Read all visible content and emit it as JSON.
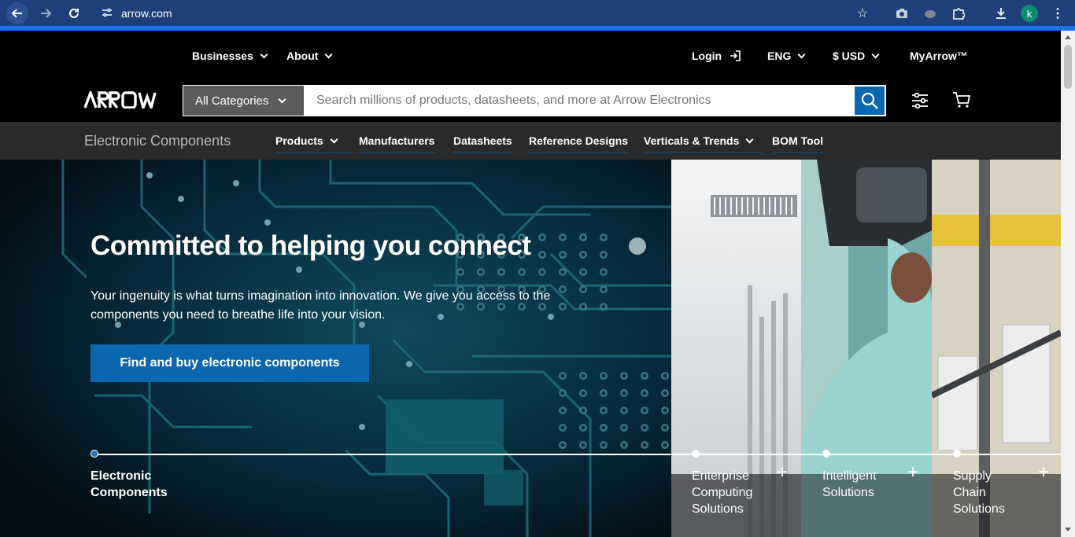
{
  "browser": {
    "url": "arrow.com",
    "profile_initial": "k"
  },
  "header": {
    "top_left": [
      {
        "label": "Businesses"
      },
      {
        "label": "About"
      }
    ],
    "login": "Login",
    "language": "ENG",
    "currency": "$ USD",
    "myarrow": "MyArrow™"
  },
  "search": {
    "category": "All Categories",
    "placeholder": "Search millions of products, datasheets, and more at Arrow Electronics"
  },
  "subnav": {
    "brand": "Electronic Components",
    "items": [
      {
        "label": "Products",
        "has_dropdown": true
      },
      {
        "label": "Manufacturers"
      },
      {
        "label": "Datasheets"
      },
      {
        "label": "Reference Designs"
      },
      {
        "label": "Verticals & Trends",
        "has_dropdown": true
      },
      {
        "label": "BOM Tool"
      }
    ]
  },
  "hero": {
    "title": "Committed to helping you connect",
    "body": "Your ingenuity is what turns imagination into innovation. We give you access to the components you need to breathe life into your vision.",
    "cta": "Find and buy electronic components"
  },
  "segments": [
    {
      "label_line1": "Electronic",
      "label_line2": "Components",
      "label_line3": "",
      "active": true
    },
    {
      "label_line1": "Enterprise",
      "label_line2": "Computing",
      "label_line3": "Solutions",
      "active": false
    },
    {
      "label_line1": "Intelligent",
      "label_line2": "Solutions",
      "label_line3": "",
      "active": false
    },
    {
      "label_line1": "Supply",
      "label_line2": "Chain",
      "label_line3": "Solutions",
      "active": false
    }
  ],
  "colors": {
    "brand_blue": "#0b67b0",
    "subnav_bg": "#2b2a2a",
    "chrome_bg": "#1f3f7a"
  }
}
